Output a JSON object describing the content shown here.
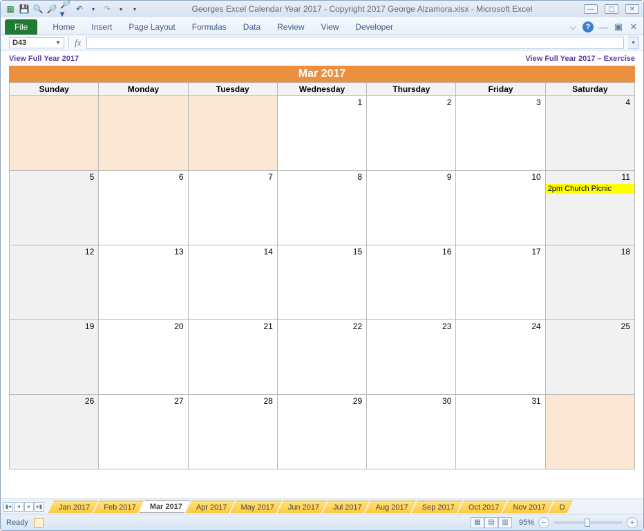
{
  "window": {
    "title": "Georges Excel Calendar Year 2017  -  Copyright 2017 George Alzamora.xlsx  -  Microsoft Excel"
  },
  "ribbon": {
    "file": "File",
    "tabs": [
      "Home",
      "Insert",
      "Page Layout",
      "Formulas",
      "Data",
      "Review",
      "View",
      "Developer"
    ]
  },
  "formula_bar": {
    "name_box": "D43",
    "formula": ""
  },
  "sheet_links": {
    "left": "View Full Year 2017",
    "right": "View Full Year 2017 – Exercise"
  },
  "calendar": {
    "title": "Mar 2017",
    "day_headers": [
      "Sunday",
      "Monday",
      "Tuesday",
      "Wednesday",
      "Thursday",
      "Friday",
      "Saturday"
    ],
    "weeks": [
      [
        {
          "num": "",
          "cls": "prev"
        },
        {
          "num": "",
          "cls": "prev"
        },
        {
          "num": "",
          "cls": "prev"
        },
        {
          "num": "1",
          "cls": ""
        },
        {
          "num": "2",
          "cls": ""
        },
        {
          "num": "3",
          "cls": ""
        },
        {
          "num": "4",
          "cls": "wk"
        }
      ],
      [
        {
          "num": "5",
          "cls": "wk"
        },
        {
          "num": "6",
          "cls": ""
        },
        {
          "num": "7",
          "cls": ""
        },
        {
          "num": "8",
          "cls": ""
        },
        {
          "num": "9",
          "cls": ""
        },
        {
          "num": "10",
          "cls": ""
        },
        {
          "num": "11",
          "cls": "wk",
          "event": "2pm Church Picnic"
        }
      ],
      [
        {
          "num": "12",
          "cls": "wk"
        },
        {
          "num": "13",
          "cls": ""
        },
        {
          "num": "14",
          "cls": ""
        },
        {
          "num": "15",
          "cls": ""
        },
        {
          "num": "16",
          "cls": ""
        },
        {
          "num": "17",
          "cls": ""
        },
        {
          "num": "18",
          "cls": "wk"
        }
      ],
      [
        {
          "num": "19",
          "cls": "wk"
        },
        {
          "num": "20",
          "cls": ""
        },
        {
          "num": "21",
          "cls": ""
        },
        {
          "num": "22",
          "cls": ""
        },
        {
          "num": "23",
          "cls": ""
        },
        {
          "num": "24",
          "cls": ""
        },
        {
          "num": "25",
          "cls": "wk"
        }
      ],
      [
        {
          "num": "26",
          "cls": "wk"
        },
        {
          "num": "27",
          "cls": ""
        },
        {
          "num": "28",
          "cls": ""
        },
        {
          "num": "29",
          "cls": ""
        },
        {
          "num": "30",
          "cls": ""
        },
        {
          "num": "31",
          "cls": ""
        },
        {
          "num": "",
          "cls": "prev"
        }
      ]
    ]
  },
  "sheet_tabs": {
    "tabs": [
      "Jan 2017",
      "Feb 2017",
      "Mar 2017",
      "Apr 2017",
      "May 2017",
      "Jun 2017",
      "Jul 2017",
      "Aug 2017",
      "Sep 2017",
      "Oct 2017",
      "Nov 2017"
    ],
    "active": "Mar 2017",
    "partial": "D"
  },
  "status_bar": {
    "state": "Ready",
    "zoom": "95%"
  }
}
